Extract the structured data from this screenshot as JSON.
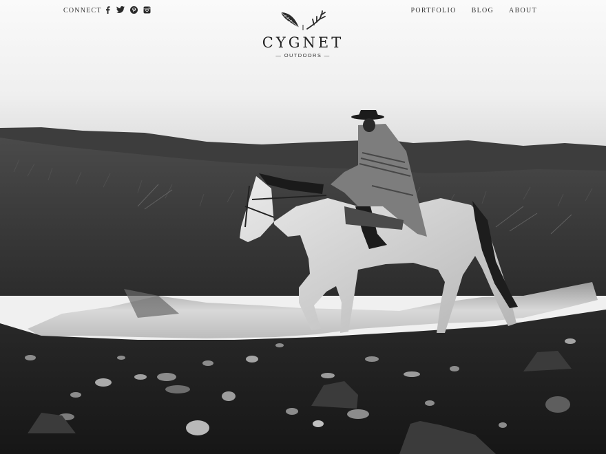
{
  "header": {
    "connect_label": "CONNECT",
    "social_icons": [
      "facebook-icon",
      "twitter-icon",
      "pinterest-icon",
      "instagram-icon"
    ],
    "nav": [
      {
        "label": "PORTFOLIO"
      },
      {
        "label": "BLOG"
      },
      {
        "label": "ABOUT"
      }
    ]
  },
  "logo": {
    "brand": "CYGNET",
    "tagline": "— OUTDOORS —",
    "icons": [
      "feather-icon",
      "antlers-icon"
    ]
  },
  "hero": {
    "image": "black-and-white photo of gaucho on white horse crossing a stream"
  },
  "colors": {
    "text": "#333333",
    "background": "#f2f2f2",
    "ground": "#1e1e1e"
  }
}
